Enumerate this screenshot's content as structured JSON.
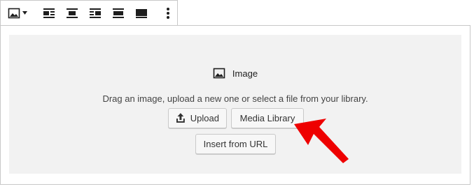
{
  "toolbar": {
    "block_switcher": {
      "icon": "image-icon",
      "dropdown_icon": "caret-down-icon"
    },
    "alignment_buttons": [
      {
        "icon": "align-left-icon"
      },
      {
        "icon": "align-center-icon"
      },
      {
        "icon": "align-right-icon"
      },
      {
        "icon": "align-wide-icon"
      },
      {
        "icon": "align-full-width-icon"
      }
    ],
    "more_options_icon": "more-vertical-icon"
  },
  "image_block": {
    "label": "Image",
    "instructions": "Drag an image, upload a new one or select a file from your library.",
    "buttons": {
      "upload": "Upload",
      "media_library": "Media Library",
      "insert_from_url": "Insert from URL"
    }
  },
  "colors": {
    "placeholder_bg": "#f2f2f2",
    "border": "#c8c8c8",
    "button_bg": "#f7f7f7",
    "annotation_arrow": "#ee0000"
  }
}
